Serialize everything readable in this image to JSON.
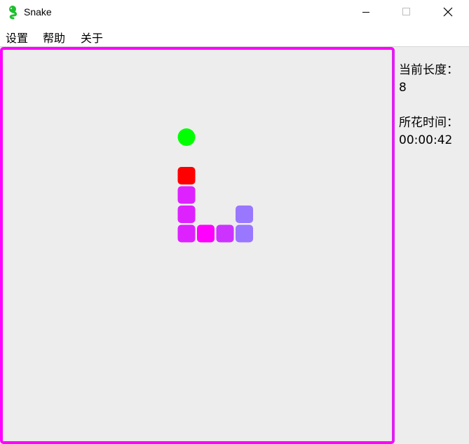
{
  "window": {
    "title": "Snake",
    "minimize_glyph": "—",
    "maximize_glyph": "□",
    "close_glyph": "✕"
  },
  "menu": {
    "items": [
      {
        "label": "设置"
      },
      {
        "label": "帮助"
      },
      {
        "label": "关于"
      }
    ]
  },
  "side_panel": {
    "length_label": "当前长度：",
    "length_value": "8",
    "time_label": "所花时间：",
    "time_value": "00:00:42"
  },
  "game": {
    "grid_columns": 20,
    "grid_rows": 20,
    "food": {
      "col": 9,
      "row": 4,
      "color": "#00ff00"
    },
    "snake": [
      {
        "col": 9,
        "row": 6,
        "color": "#ff0000",
        "role": "head"
      },
      {
        "col": 9,
        "row": 7,
        "color": "#dd22ff"
      },
      {
        "col": 9,
        "row": 8,
        "color": "#dd22ff"
      },
      {
        "col": 9,
        "row": 9,
        "color": "#dd22ff"
      },
      {
        "col": 10,
        "row": 9,
        "color": "#ff00ff"
      },
      {
        "col": 11,
        "row": 9,
        "color": "#cc33ff"
      },
      {
        "col": 12,
        "row": 9,
        "color": "#9977ff"
      },
      {
        "col": 12,
        "row": 8,
        "color": "#9977ff"
      }
    ],
    "border_colors": {
      "magenta": "#ff00ff",
      "cyan": "#00ffff",
      "violet": "#9966ff"
    }
  },
  "colors": {
    "background": "#ededed",
    "titlebar": "#ffffff",
    "app_icon_green": "#1fbf2f"
  }
}
